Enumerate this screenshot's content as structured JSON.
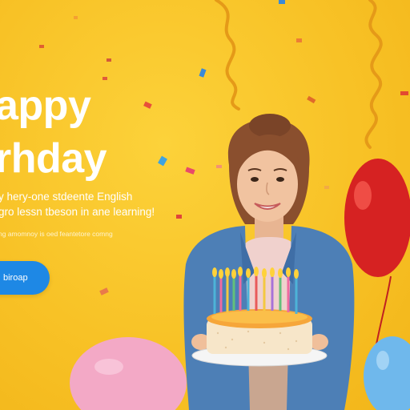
{
  "banner": {
    "headline_line1": "appy",
    "headline_line2": "rhday",
    "subtitle_line1": "y hery-one stdeente English",
    "subtitle_line2": "gro lessn tbeson in ane learning!",
    "fine_print": "ng amomnoy is oed feantetore comng",
    "cta_label": "biroap"
  },
  "colors": {
    "background": "#f8c226",
    "text": "#ffffff",
    "cta": "#1e88e5",
    "balloon_red": "#d62222",
    "balloon_pink": "#f3a9c6",
    "balloon_blue": "#6fb8ec"
  },
  "decorations": {
    "confetti_icon": "confetti-icon",
    "streamer_icon": "ribbon-streamer-icon",
    "cake_icon": "birthday-cake-icon",
    "balloon_icon": "balloon-icon"
  }
}
